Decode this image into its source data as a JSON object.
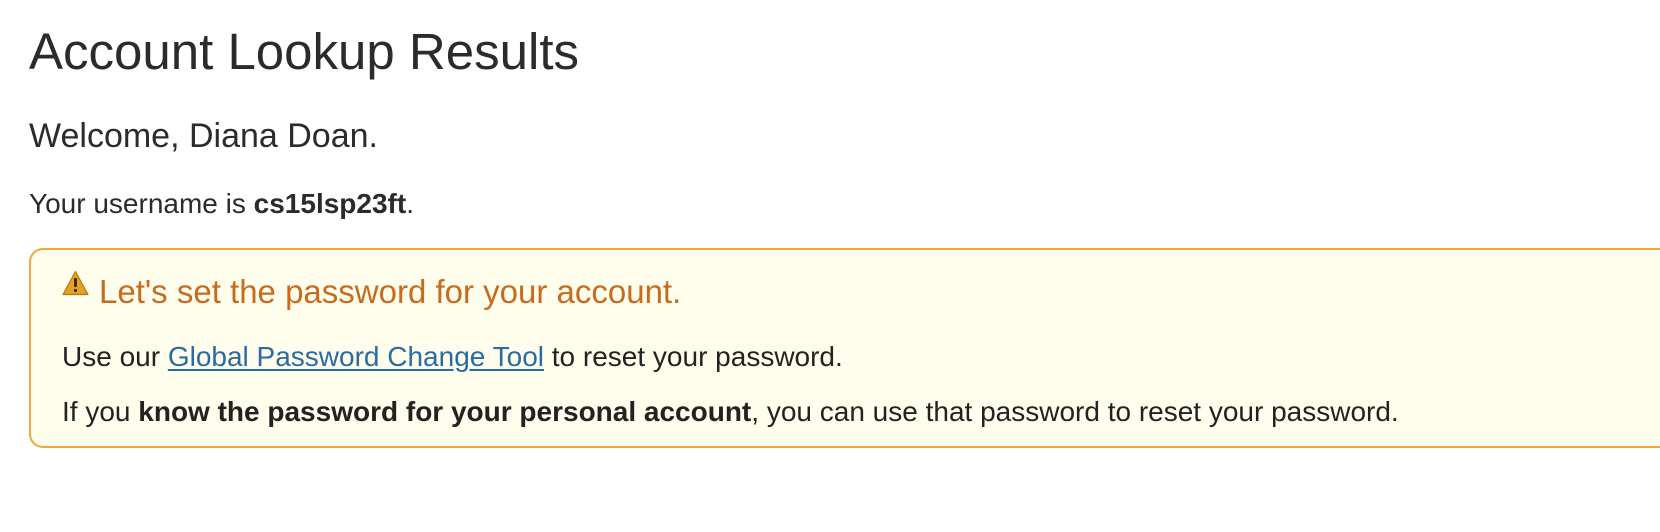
{
  "page": {
    "title": "Account Lookup Results",
    "welcome": "Welcome, Diana Doan.",
    "username_prefix": "Your username is ",
    "username": "cs15lsp23ft",
    "username_suffix": "."
  },
  "alert": {
    "icon": "warning-icon",
    "icon_color": "#e3a223",
    "title": "Let's set the password for your account.",
    "title_color": "#c86b1c",
    "border_color": "#f0a83a",
    "background_color": "#fffeec",
    "line1": {
      "prefix": "Use our ",
      "link_text": "Global Password Change Tool",
      "suffix": " to reset your password."
    },
    "line2": {
      "prefix": "If you ",
      "bold": "know the password for your personal account",
      "suffix": ", you can use that password to reset your password."
    }
  },
  "colors": {
    "link": "#2a6ba4",
    "text": "#2b2b2b"
  }
}
